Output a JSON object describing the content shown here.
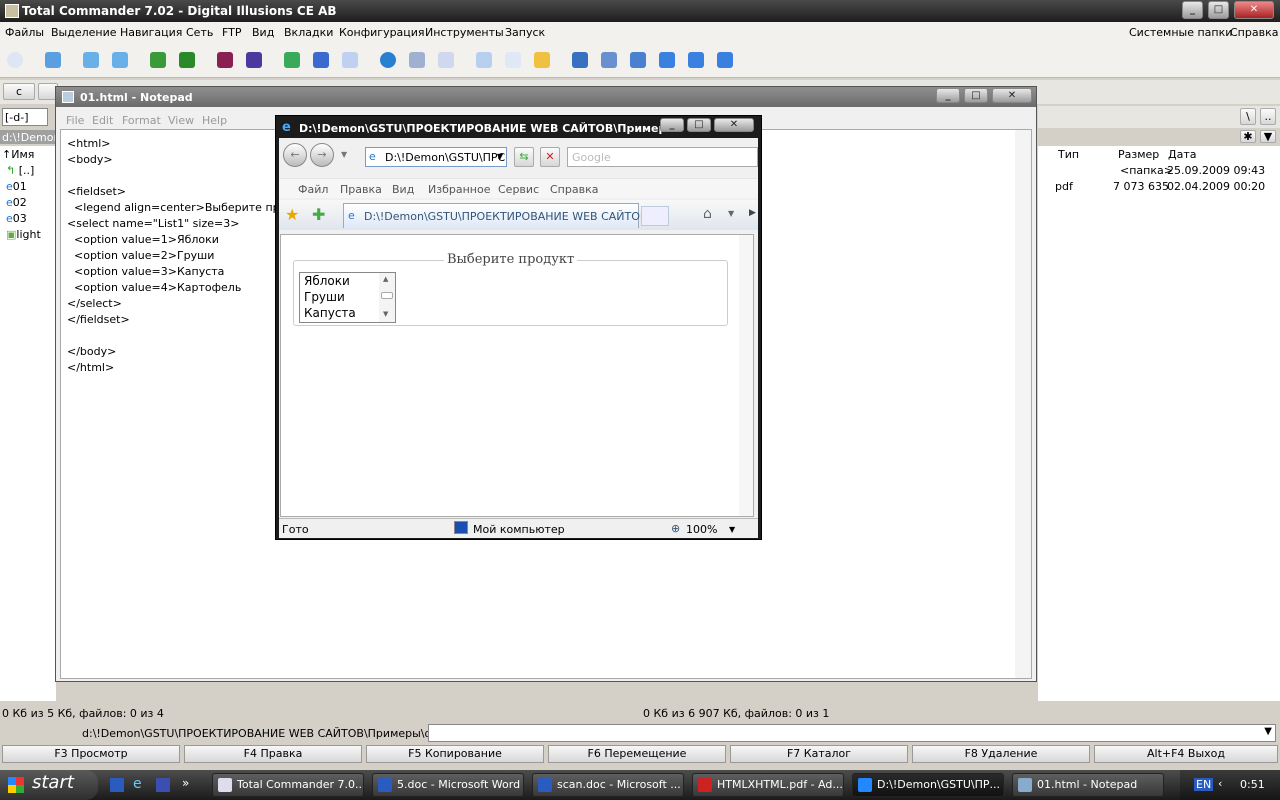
{
  "tc": {
    "title": "Total Commander 7.02 - Digital Illusions CE AB",
    "menu": [
      "Файлы",
      "Выделение",
      "Навигация",
      "Сеть",
      "FTP",
      "Вид",
      "Вкладки",
      "Конфигурация",
      "Инструменты",
      "Запуск"
    ],
    "menu_right": [
      "Системные папки",
      "Справка"
    ],
    "drive_left": "c",
    "drive_combo": "[-d-]",
    "left_path": "d:\\!Demon",
    "left_header": "↑Имя",
    "left_files": [
      "[..]",
      "01",
      "02",
      "03",
      "light"
    ],
    "right_headers": [
      "Тип",
      "Размер",
      "Дата"
    ],
    "right_rows": [
      {
        "type": "",
        "size": "<папка>",
        "date": "25.09.2009 09:43"
      },
      {
        "type": "pdf",
        "size": "7 073 635",
        "date": "02.04.2009 00:20"
      }
    ],
    "left_status": "0 Кб из 5 Кб, файлов: 0 из 4",
    "right_status": "0 Кб из 6 907 Кб, файлов: 0 из 1",
    "cmd_path": "d:\\!Demon\\GSTU\\ПРОЕКТИРОВАНИЕ WEB САЙТОВ\\Примеры\\формы>",
    "fkeys": [
      "F3 Просмотр",
      "F4 Правка",
      "F5 Копирование",
      "F6 Перемещение",
      "F7 Каталог",
      "F8 Удаление",
      "Alt+F4 Выход"
    ]
  },
  "notepad": {
    "title": "01.html - Notepad",
    "menu": [
      "File",
      "Edit",
      "Format",
      "View",
      "Help"
    ],
    "content": "<html>\n<body>\n\n<fieldset>\n  <legend align=center>Выберите пр\n<select name=\"List1\" size=3>\n  <option value=1>Яблоки\n  <option value=2>Груши\n  <option value=3>Капуста\n  <option value=4>Картофель\n</select>\n</fieldset>\n\n</body>\n</html>"
  },
  "ie": {
    "title": "D:\\!Demon\\GSTU\\ПРОЕКТИРОВАНИЕ WEB САЙТОВ\\Пример...",
    "address": "D:\\!Demon\\GSTU\\ПРС",
    "search_placeholder": "Google",
    "menu": [
      "Файл",
      "Правка",
      "Вид",
      "Избранное",
      "Сервис",
      "Справка"
    ],
    "tab_title": "D:\\!Demon\\GSTU\\ПРОЕКТИРОВАНИЕ WEB САЙТОВ\\...",
    "legend": "Выберите продукт",
    "options": [
      "Яблоки",
      "Груши",
      "Капуста"
    ],
    "status": "Гото",
    "zone": "Мой компьютер",
    "zoom": "100%"
  },
  "taskbar": {
    "start": "start",
    "items": [
      "Total Commander 7.0...",
      "5.doc - Microsoft Word",
      "scan.doc - Microsoft ...",
      "HTMLXHTML.pdf - Ad...",
      "D:\\!Demon\\GSTU\\ПР...",
      "01.html - Notepad"
    ],
    "lang": "EN",
    "time": "0:51"
  }
}
